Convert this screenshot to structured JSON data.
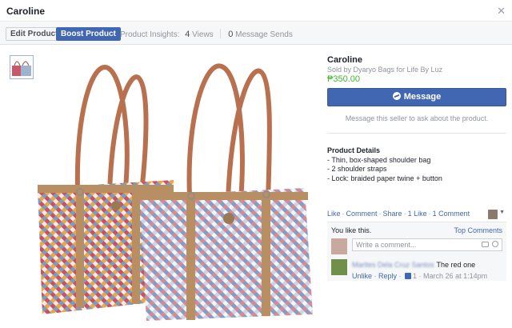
{
  "window": {
    "title": "Caroline"
  },
  "toolbar": {
    "edit_label": "Edit Product",
    "boost_label": "Boost Product",
    "insights_label": "Product Insights:",
    "views_count": "4",
    "views_label": "Views",
    "sends_count": "0",
    "sends_label": "Message Sends"
  },
  "product": {
    "title": "Caroline",
    "seller": "Sold by Dyaryo Bags for Life By Luz",
    "price": "₱350.00",
    "message_button": "Message",
    "message_hint": "Message this seller to ask about the product.",
    "details_heading": "Product Details",
    "details": [
      "- Thin, box-shaped shoulder bag",
      "- 2 shoulder straps",
      "- Lock: braided paper twine + button"
    ]
  },
  "actions": {
    "like": "Like",
    "comment": "Comment",
    "share": "Share",
    "likes_count": "1 Like",
    "comments_count": "1 Comment"
  },
  "comments": {
    "you_like": "You like this.",
    "sort": "Top Comments",
    "placeholder": "Write a comment...",
    "items": [
      {
        "author": "Marites Dela Cruz Santos",
        "text": "The red one",
        "unlike": "Unlike",
        "reply": "Reply",
        "likes": "1",
        "time": "March 26 at 1:14pm"
      }
    ]
  },
  "colors": {
    "accent": "#4267b2",
    "price": "#42b72a",
    "muted": "#90949c"
  },
  "icons": {
    "close": "close-icon",
    "messenger": "messenger-icon",
    "camera": "camera-icon",
    "sticker": "sticker-icon",
    "thumb": "thumbs-up-icon"
  }
}
